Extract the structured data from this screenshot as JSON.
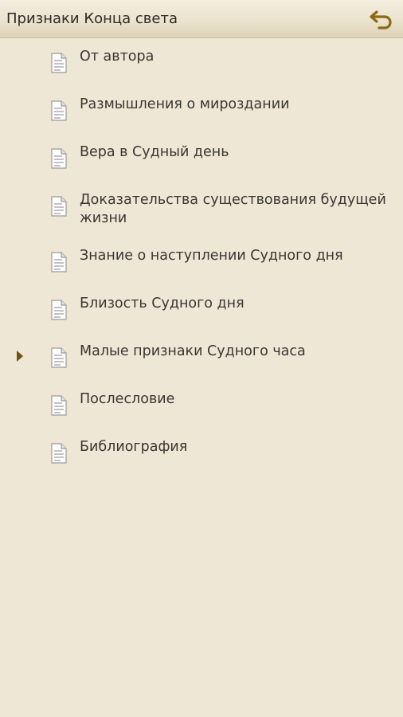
{
  "header": {
    "title": "Признаки Конца света",
    "back_icon": "back-arrow-icon",
    "icon_color": "#8a6a12"
  },
  "toc": {
    "items": [
      {
        "label": "От автора"
      },
      {
        "label": "Размышления о мироздании"
      },
      {
        "label": "Вера в Судный день"
      },
      {
        "label": "Доказательства существования будущей жизни"
      },
      {
        "label": "Знание о наступлении Судного дня"
      },
      {
        "label": "Близость Судного дня"
      },
      {
        "label": "Малые признаки Судного часа",
        "current": true
      },
      {
        "label": "Послесловие"
      },
      {
        "label": "Библиография"
      }
    ],
    "item_icon": "document-icon",
    "current_marker_icon": "triangle-right-icon",
    "marker_color": "#6b5410"
  }
}
